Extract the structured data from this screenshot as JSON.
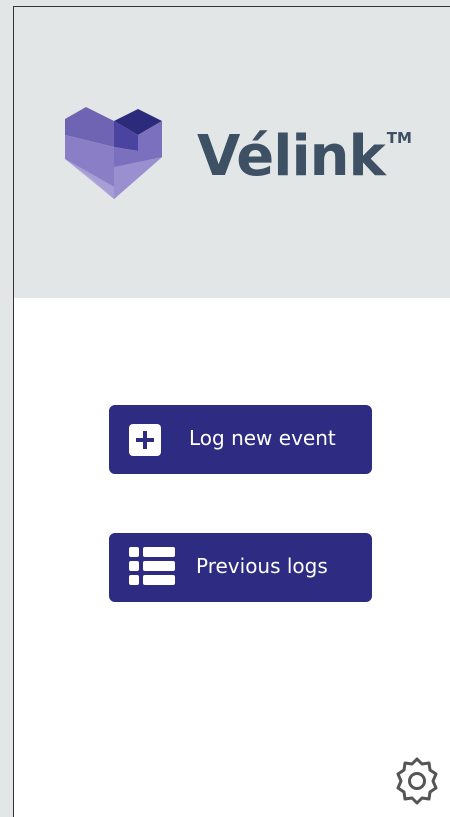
{
  "brand": {
    "name": "Vélink",
    "trademark": "TM",
    "text_color": "#3d5064",
    "logo_colors": [
      "#2c2a7a",
      "#6f64b3",
      "#8a7fc6",
      "#b2aadd"
    ]
  },
  "actions": {
    "log_new_event": {
      "label": "Log new event",
      "icon": "plus-square-icon"
    },
    "previous_logs": {
      "label": "Previous logs",
      "icon": "list-icon"
    }
  },
  "settings": {
    "icon": "gear-icon"
  },
  "colors": {
    "header_bg": "#e3e6e6",
    "content_bg": "#ffffff",
    "button_bg": "#2e2b83",
    "button_text": "#ffffff",
    "icon_stroke": "#555555"
  }
}
